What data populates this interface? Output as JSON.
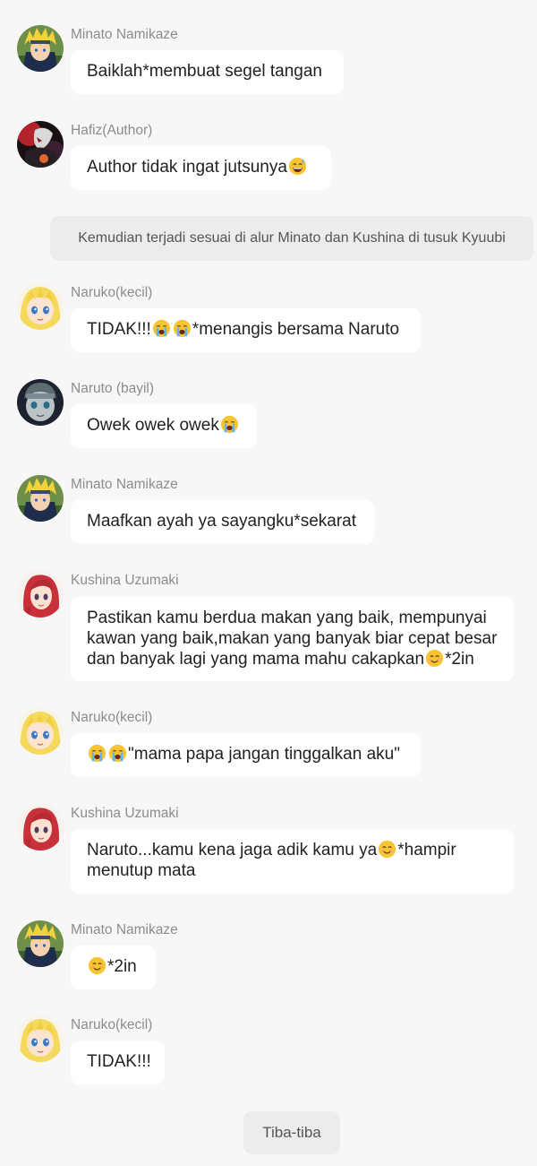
{
  "colors": {
    "background": "#f7f7f7",
    "bubble": "#ffffff",
    "narration_bg": "#ececec",
    "name_text": "#8c8c8c",
    "message_text": "#222222"
  },
  "messages": [
    {
      "sender": "Minato Namikaze",
      "avatar": "minato-avatar",
      "text": "Baiklah*membuat segel tangan"
    },
    {
      "sender": "Hafiz(Author)",
      "avatar": "author-avatar",
      "text": "Author tidak ingat jutsunya",
      "emoji": "grinning-sweat-emoji"
    },
    {
      "narration": "Kemudian terjadi sesuai di alur Minato dan Kushina di tusuk Kyuubi"
    },
    {
      "sender": "Naruko(kecil)",
      "avatar": "naruko-avatar",
      "text_before": "TIDAK!!!",
      "emoji": "crying-emoji",
      "text_after": "*menangis bersama Naruto"
    },
    {
      "sender": "Naruto (bayil)",
      "avatar": "naruto-avatar",
      "text": "Owek owek owek",
      "emoji": "crying-emoji"
    },
    {
      "sender": "Minato Namikaze",
      "avatar": "minato-avatar",
      "text": "Maafkan ayah ya sayangku*sekarat"
    },
    {
      "sender": "Kushina Uzumaki",
      "avatar": "kushina-avatar",
      "lines": [
        "Pastikan kamu berdua makan yang baik, mempunyai",
        "kawan yang baik,makan yang banyak biar cepat besar",
        "dan banyak lagi yang mama mahu cakapkan"
      ],
      "emoji": "smiling-emoji",
      "text_after": "*2in"
    },
    {
      "sender": "Naruko(kecil)",
      "avatar": "naruko-avatar",
      "emoji": "crying-emoji",
      "text_after": "\"mama papa jangan tinggalkan aku\""
    },
    {
      "sender": "Kushina Uzumaki",
      "avatar": "kushina-avatar",
      "text_before": "Naruto...kamu kena jaga adik kamu ya",
      "emoji": "smiling-emoji",
      "text_after": "*hampir",
      "line2": "menutup mata"
    },
    {
      "sender": "Minato Namikaze",
      "avatar": "minato-avatar",
      "emoji": "smiling-emoji",
      "text_after": "*2in"
    },
    {
      "sender": "Naruko(kecil)",
      "avatar": "naruko-avatar",
      "text": "TIDAK!!!"
    },
    {
      "narration": "Tiba-tiba"
    }
  ]
}
